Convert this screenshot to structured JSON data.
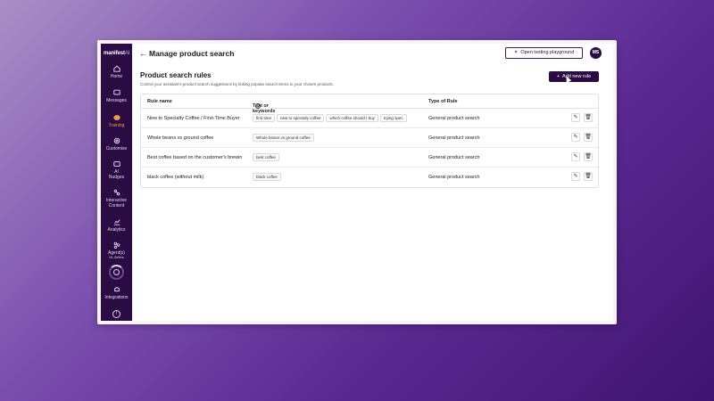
{
  "sidebar": {
    "logo_main": "manifest",
    "logo_ai": "AI",
    "items": [
      {
        "label": "Home"
      },
      {
        "label": "Messages"
      },
      {
        "label": "Training"
      },
      {
        "label": "Customise"
      },
      {
        "label": "AI Nudges"
      },
      {
        "label": "Interactive Content"
      },
      {
        "label": "Analytics"
      },
      {
        "label": "Agent(s)"
      },
      {
        "label": "Integrations"
      }
    ],
    "agent_sub": "NL-Sellers"
  },
  "header": {
    "title": "Manage product search",
    "playground_button": "Open testing playground",
    "avatar_initials": "MS"
  },
  "section": {
    "title": "Product search rules",
    "subtitle": "Control your assistant's product search suggestions by linking popular search terms to your chosen products.",
    "add_button": "Add new rule"
  },
  "table": {
    "headers": {
      "name": "Rule name",
      "keywords": "Text or keywords",
      "type": "Type of Rule"
    },
    "rows": [
      {
        "name": "New to Specialty Coffee / First-Time Buyer",
        "tags": [
          "first time",
          "new to specialty coffee",
          "which coffee should I buy",
          "trying spec"
        ],
        "type": "General product search"
      },
      {
        "name": "Whole beans vs ground coffee",
        "tags": [
          "Whole beans vs ground coffee"
        ],
        "type": "General product search"
      },
      {
        "name": "Best coffee based on the customer's brewing method",
        "tags": [
          "best coffee"
        ],
        "type": "General product search"
      },
      {
        "name": "black coffee (without milk)",
        "tags": [
          "black coffee"
        ],
        "type": "General product search"
      }
    ]
  },
  "colors": {
    "sidebar": "#2a0b44",
    "active": "#f0a040",
    "primary": "#2a0b44"
  }
}
